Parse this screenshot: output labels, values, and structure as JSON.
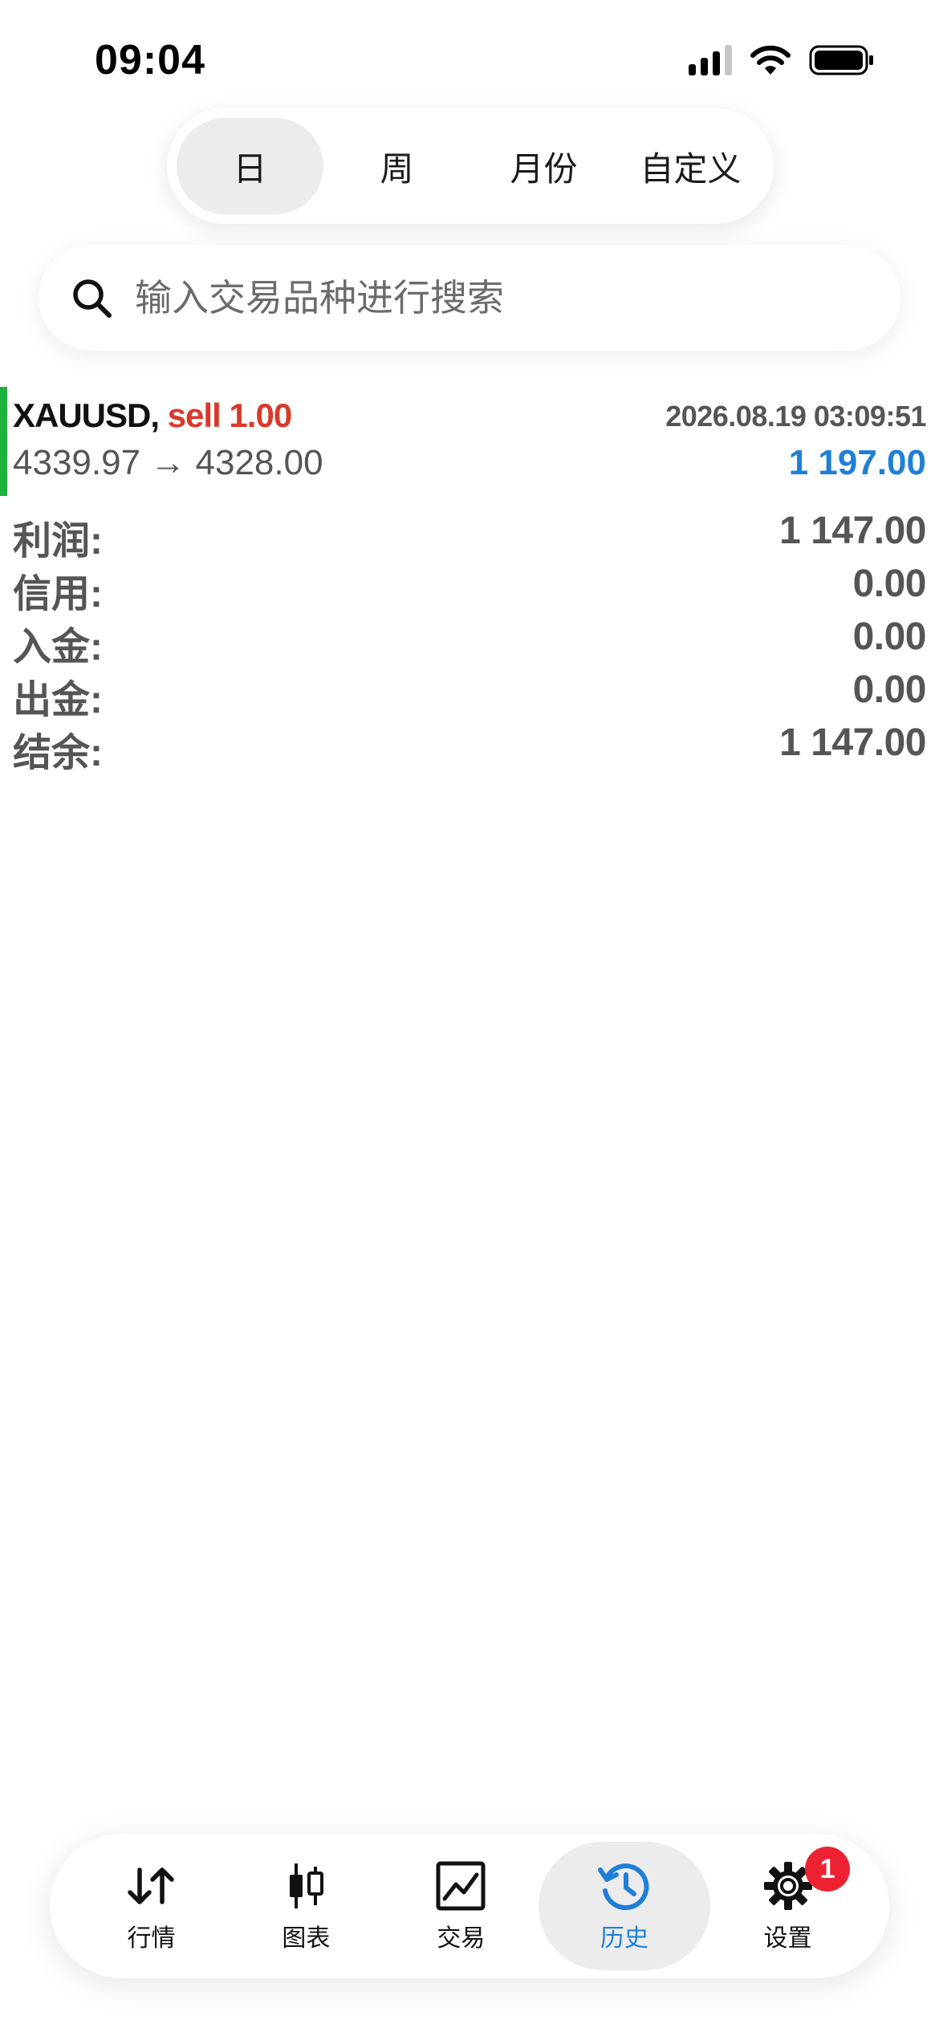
{
  "status_bar": {
    "time": "09:04"
  },
  "period_tabs": [
    {
      "label": "日",
      "active": true
    },
    {
      "label": "周",
      "active": false
    },
    {
      "label": "月份",
      "active": false
    },
    {
      "label": "自定义",
      "active": false
    }
  ],
  "search": {
    "placeholder": "输入交易品种进行搜索",
    "value": ""
  },
  "deal": {
    "symbol": "XAUUSD,",
    "type": "sell 1.00",
    "datetime": "2026.08.19 03:09:51",
    "prices": "4339.97 → 4328.00",
    "profit": "1 197.00",
    "profit_color": "#1e7fd8",
    "type_color": "#d8392b",
    "bar_color": "#1fb240"
  },
  "summary": [
    {
      "label": "利润:",
      "value": "1 147.00"
    },
    {
      "label": "信用:",
      "value": "0.00"
    },
    {
      "label": "入金:",
      "value": "0.00"
    },
    {
      "label": "出金:",
      "value": "0.00"
    },
    {
      "label": "结余:",
      "value": "1 147.00"
    }
  ],
  "tabbar": [
    {
      "label": "行情",
      "icon": "quotes-arrows-icon",
      "active": false
    },
    {
      "label": "图表",
      "icon": "candlestick-chart-icon",
      "active": false
    },
    {
      "label": "交易",
      "icon": "trade-line-chart-icon",
      "active": false
    },
    {
      "label": "历史",
      "icon": "history-clock-icon",
      "active": true
    },
    {
      "label": "设置",
      "icon": "gear-icon",
      "active": false,
      "badge": "1"
    }
  ],
  "colors": {
    "accent": "#1e7fd8",
    "badge": "#ec2232"
  }
}
